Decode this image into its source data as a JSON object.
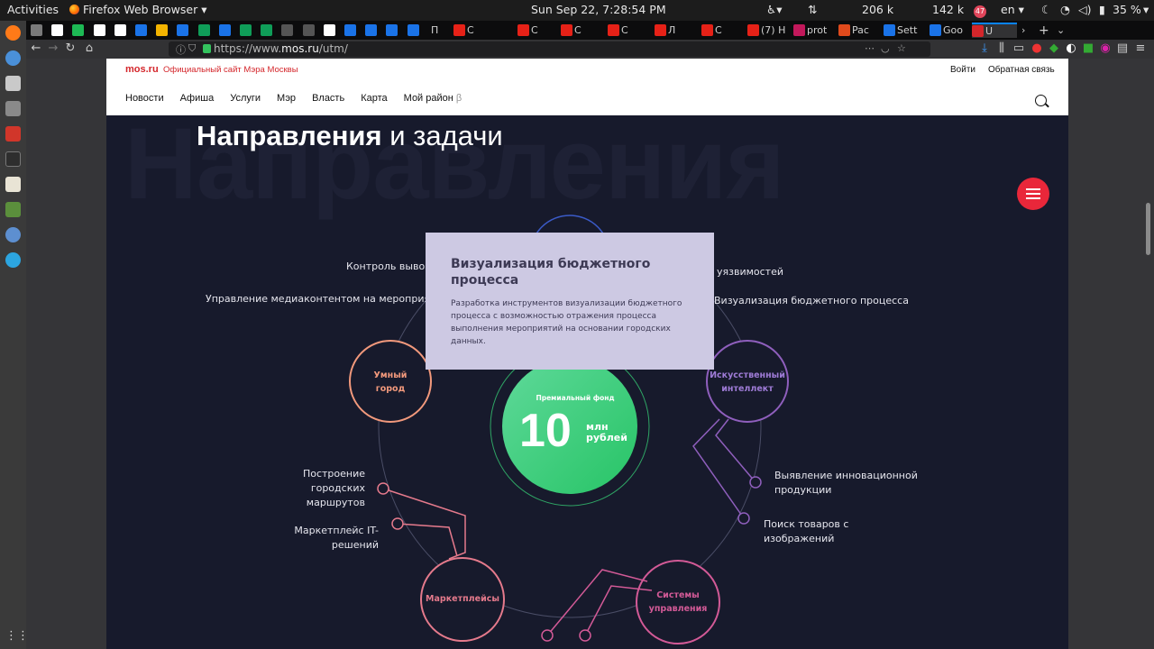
{
  "gnome": {
    "activities": "Activities",
    "app_name": "Firefox Web Browser",
    "clock": "Sun Sep 22,  7:28:54 PM",
    "net_down": "206 k",
    "net_up": "142 k",
    "notif_count": "47",
    "lang": "en",
    "battery": "35 %"
  },
  "tabs": [
    {
      "label": "П",
      "color": "#7a7a7a"
    },
    {
      "label": "C",
      "color": "#e62117"
    },
    {
      "label": "C",
      "color": "#e62117"
    },
    {
      "label": "C",
      "color": "#e62117"
    },
    {
      "label": "C",
      "color": "#e62117"
    },
    {
      "label": "Л",
      "color": "#e62117"
    },
    {
      "label": "C",
      "color": "#e62117"
    },
    {
      "label": "(7) H",
      "color": "#e62117"
    },
    {
      "label": "prot",
      "color": "#c2185b"
    },
    {
      "label": "Pac",
      "color": "#e04a1c"
    },
    {
      "label": "Sett",
      "color": "#1a73e8"
    },
    {
      "label": "Goo",
      "color": "#1a73e8"
    },
    {
      "label": "U",
      "color": "#d4262b"
    }
  ],
  "navbar": {
    "url_prefix": "https://www.",
    "url_domain": "mos.ru",
    "url_path": "/utm/"
  },
  "site": {
    "logo": "mos.ru",
    "logo_subtitle": "Официальный сайт Мэра Москвы",
    "login": "Войти",
    "feedback": "Обратная связь",
    "menu": [
      "Новости",
      "Афиша",
      "Услуги",
      "Мэр",
      "Власть",
      "Карта",
      "Мой район"
    ],
    "menu_beta": "β"
  },
  "section": {
    "title_bold": "Направления",
    "title_rest": " и задачи",
    "bg_word": "Направления"
  },
  "fund": {
    "caption": "Премиальный фонд",
    "amount": "10",
    "unit_line1": "млн",
    "unit_line2": "рублей"
  },
  "nodes": {
    "smart_city_1": "Умный",
    "smart_city_2": "город",
    "ai_1": "Искусственный",
    "ai_2": "интеллект",
    "marketplaces": "Маркетплейсы",
    "systems_1": "Системы",
    "systems_2": "управления"
  },
  "labels": {
    "waste": "Контроль вывоза",
    "vuln": "уязвимостей",
    "media": "Управление медиаконтентом на мероприятиях",
    "budget": "Визуализация бюджетного процесса",
    "routes_1": "Построение",
    "routes_2": "городских",
    "routes_3": "маршрутов",
    "it_1": "Маркетплейс IT-",
    "it_2": "решений",
    "innov_1": "Выявление инновационной",
    "innov_2": "продукции",
    "goods_1": "Поиск товаров с",
    "goods_2": "изображений"
  },
  "tooltip": {
    "title": "Визуализация бюджетного процесса",
    "body": "Разработка инструментов визуализации бюджетного процесса с возможностью отражения процесса выполнения мероприятий на основании городских данных."
  }
}
